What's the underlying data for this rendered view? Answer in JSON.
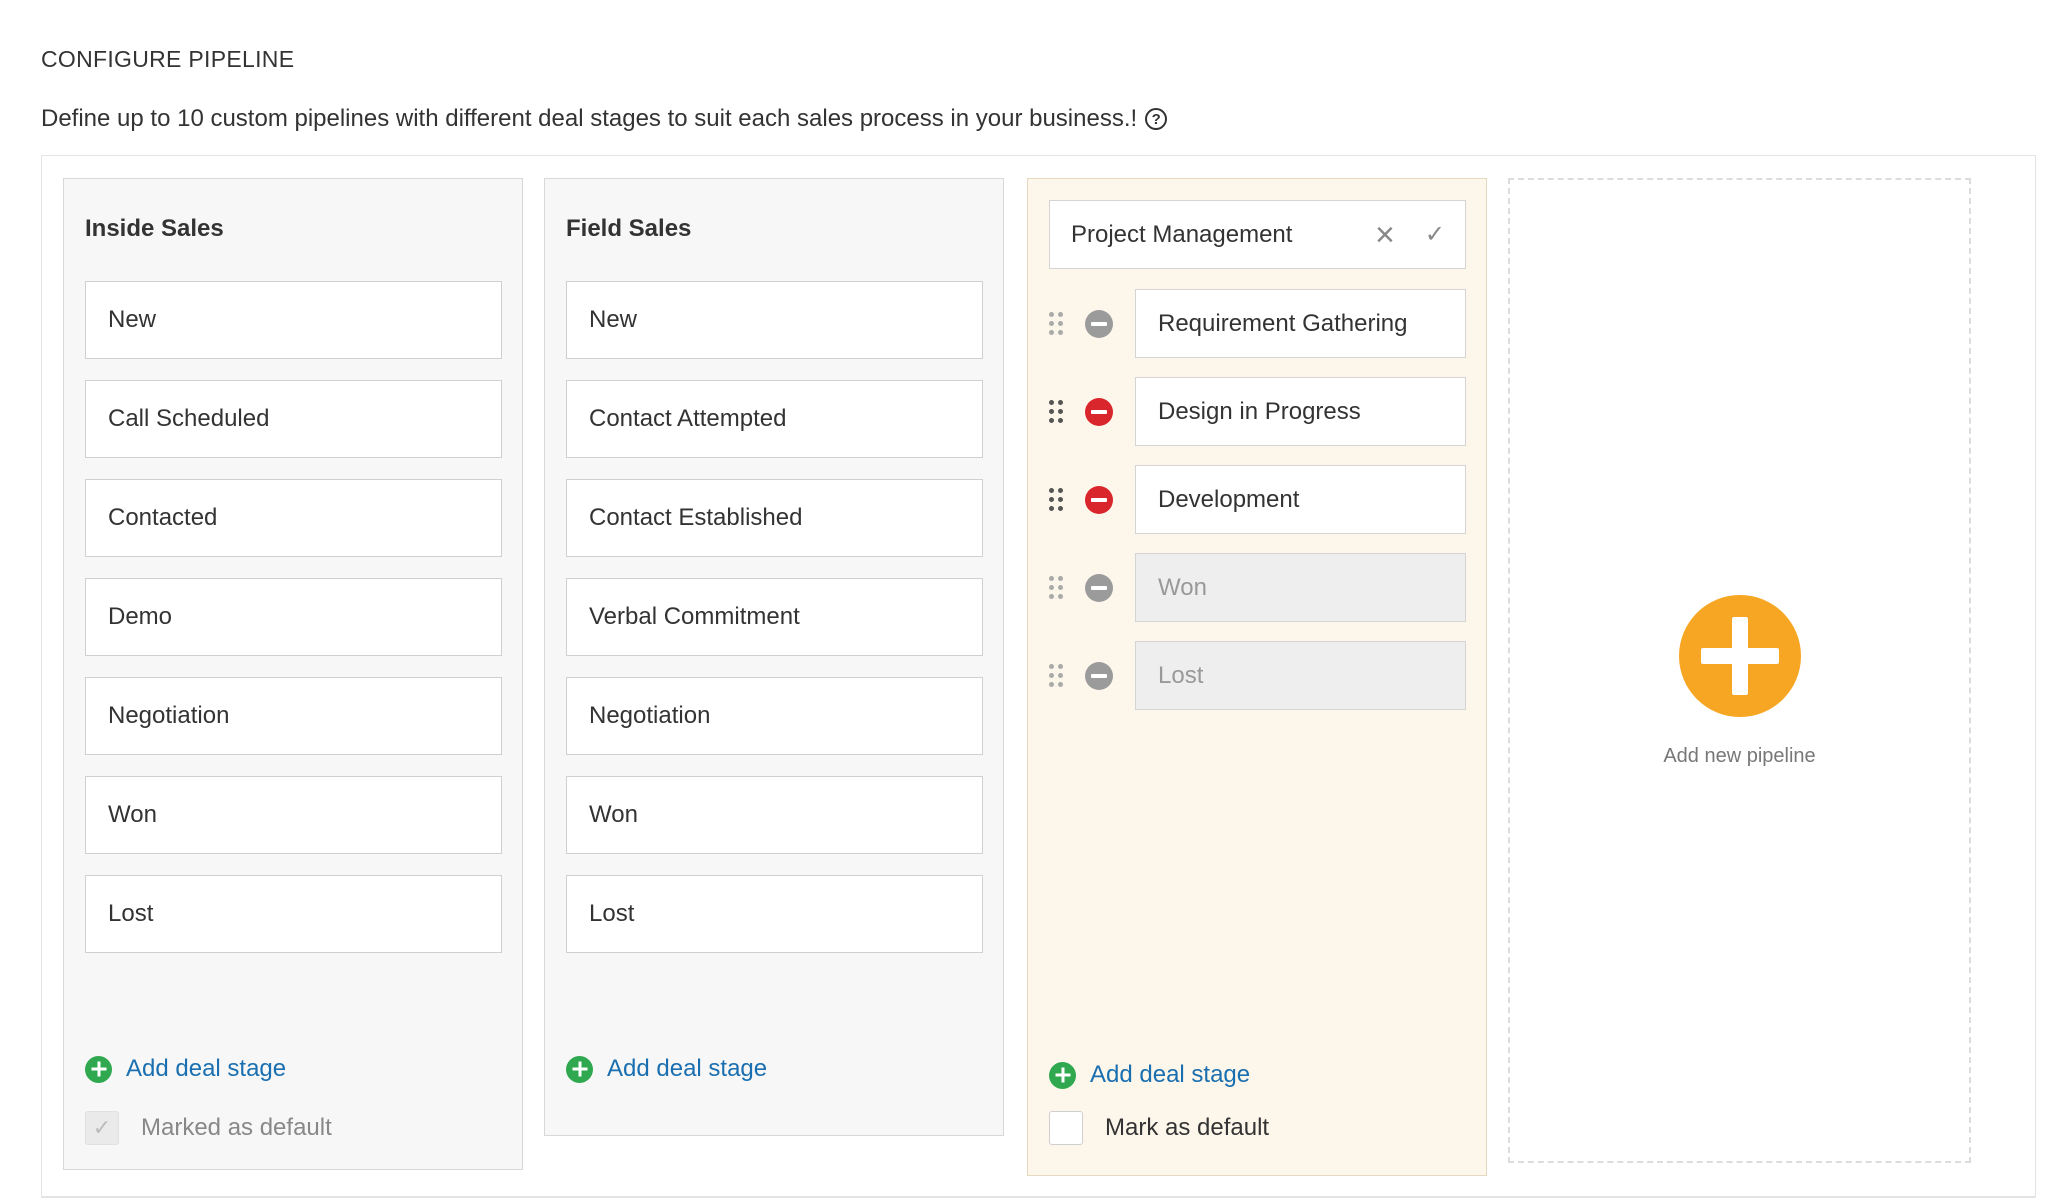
{
  "heading": "CONFIGURE PIPELINE",
  "description": "Define up to 10 custom pipelines with different deal stages to suit each sales process in your business.!",
  "pipelines": [
    {
      "title": "Inside Sales",
      "stages": [
        "New",
        "Call Scheduled",
        "Contacted",
        "Demo",
        "Negotiation",
        "Won",
        "Lost"
      ],
      "add_stage_label": "Add deal stage",
      "default_label": "Marked as default"
    },
    {
      "title": "Field Sales",
      "stages": [
        "New",
        "Contact Attempted",
        "Contact Established",
        "Verbal Commitment",
        "Negotiation",
        "Won",
        "Lost"
      ],
      "add_stage_label": "Add deal stage"
    }
  ],
  "editing": {
    "name": "Project Management",
    "stages": [
      {
        "label": "Requirement Gathering",
        "removable": false
      },
      {
        "label": "Design in Progress",
        "removable": true
      },
      {
        "label": "Development",
        "removable": true
      },
      {
        "label": "Won",
        "removable": false
      },
      {
        "label": "Lost",
        "removable": false
      }
    ],
    "add_stage_label": "Add deal stage",
    "default_label": "Mark as default"
  },
  "add_pipeline_label": "Add new pipeline",
  "colors": {
    "accent_orange": "#f6a623",
    "add_green": "#2fa84f",
    "remove_red": "#d9262c",
    "link_blue": "#1a6fb0"
  }
}
